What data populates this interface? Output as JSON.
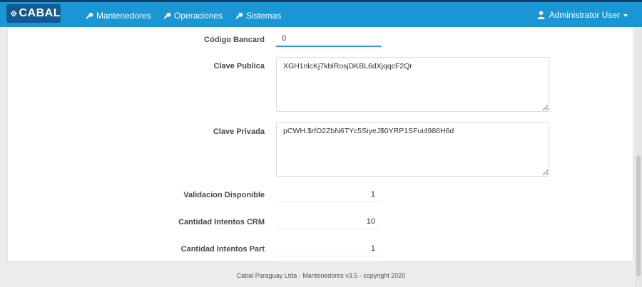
{
  "navbar": {
    "brand": "CABAL",
    "items": [
      {
        "label": "Mantenedores",
        "icon": "key-icon"
      },
      {
        "label": "Operaciones",
        "icon": "key-icon"
      },
      {
        "label": "Sistemas",
        "icon": "key-icon"
      }
    ],
    "user": {
      "label": "Administrator User",
      "icon": "user-icon"
    }
  },
  "form": {
    "codigo_bancard": {
      "label": "Código Bancard",
      "value": "0"
    },
    "clave_publica": {
      "label": "Clave Publica",
      "value": "XGH1nlcKj7kblRosjDKBL6dXjqqcF2Qr"
    },
    "clave_privada": {
      "label": "Clave Privada",
      "value": "pCWH.$rfO2ZbN6TYc5SiyeJ$0YRP1SFui4986H6d"
    },
    "validacion_disponible": {
      "label": "Validacion Disponible",
      "value": "1"
    },
    "cantidad_intentos_crm": {
      "label": "Cantidad Intentos CRM",
      "value": "10"
    },
    "cantidad_intentos_part": {
      "label": "Cantidad Intentos Part",
      "value": "1"
    }
  },
  "footer": {
    "text": "Cabal Paraguay Ltda - Mantenedores v3.5 - copyright 2020"
  },
  "colors": {
    "navbar": "#1a96d4",
    "brand_bg": "#135a92",
    "accent": "#2f9ad6"
  }
}
